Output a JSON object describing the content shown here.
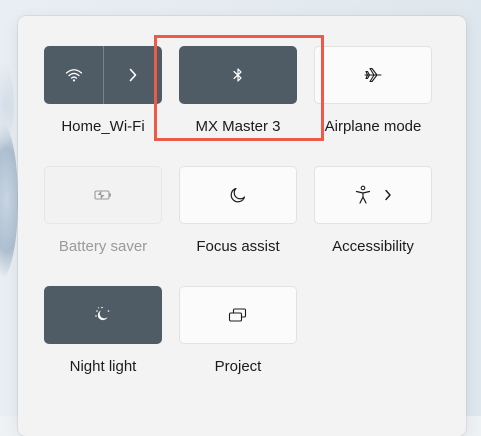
{
  "tiles": {
    "wifi": {
      "label": "Home_Wi-Fi",
      "icon": "wifi-icon",
      "state": "on"
    },
    "bluetooth": {
      "label": "MX Master 3",
      "icon": "bluetooth-icon",
      "state": "on"
    },
    "airplane": {
      "label": "Airplane mode",
      "icon": "airplane-icon",
      "state": "off"
    },
    "battery_saver": {
      "label": "Battery saver",
      "icon": "battery-saver-icon",
      "state": "disabled"
    },
    "focus_assist": {
      "label": "Focus assist",
      "icon": "moon-icon",
      "state": "off"
    },
    "accessibility": {
      "label": "Accessibility",
      "icon": "accessibility-icon",
      "state": "off"
    },
    "night_light": {
      "label": "Night light",
      "icon": "night-light-icon",
      "state": "on"
    },
    "project": {
      "label": "Project",
      "icon": "project-icon",
      "state": "off"
    }
  },
  "colors": {
    "tile_on": "#4f5b65",
    "tile_off": "#fbfbfb",
    "highlight": "#ee5a4a"
  }
}
